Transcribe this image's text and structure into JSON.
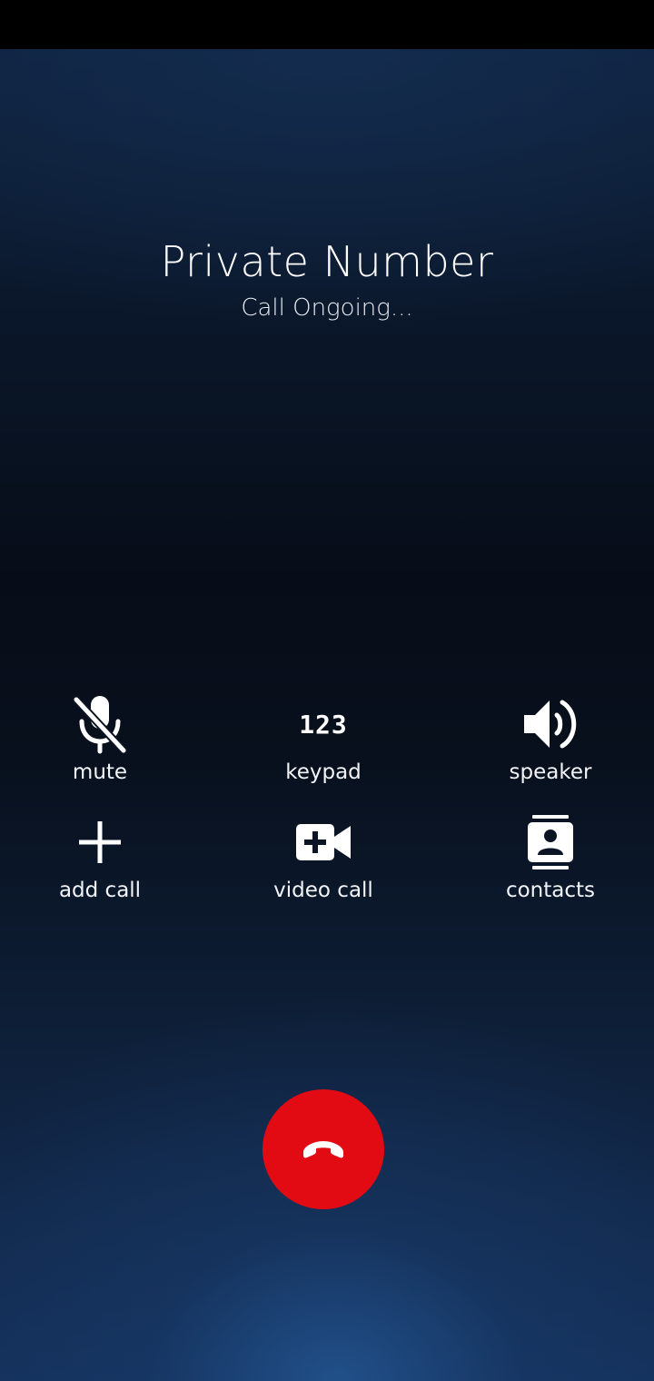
{
  "caller": {
    "name": "Private Number",
    "status": "Call Ongoing..."
  },
  "actions": [
    {
      "label": "mute",
      "icon": "mic-off-icon"
    },
    {
      "label": "keypad",
      "icon": "keypad-icon",
      "glyph": "123"
    },
    {
      "label": "speaker",
      "icon": "speaker-icon"
    },
    {
      "label": "add call",
      "icon": "plus-icon"
    },
    {
      "label": "video call",
      "icon": "video-call-icon"
    },
    {
      "label": "contacts",
      "icon": "contacts-icon"
    }
  ],
  "end_call": {
    "icon": "hang-up-icon",
    "color": "#e30b13"
  }
}
